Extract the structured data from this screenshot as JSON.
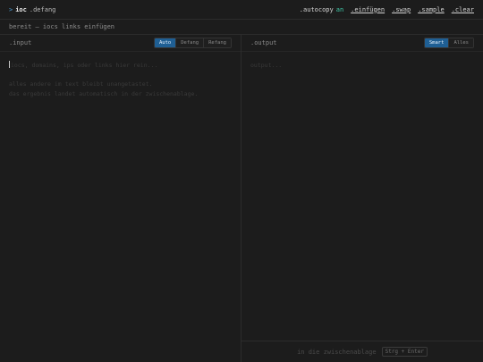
{
  "header": {
    "prompt": ">",
    "brand_bold": "ioc",
    "brand_rest": ".defang",
    "autocopy_label": ".autocopy",
    "autocopy_state": "an",
    "links": [
      ".einfügen",
      ".swap",
      ".sample",
      ".clear"
    ]
  },
  "status": {
    "text": "bereit — iocs links einfügen"
  },
  "input_pane": {
    "title": ".input",
    "modes": [
      "Auto",
      "Defang",
      "Refang"
    ],
    "active_mode": "Auto",
    "placeholder_lines": [
      "iocs, domains, ips oder links hier rein...",
      "",
      "alles andere im text bleibt unangetastet.",
      "das ergebnis landet automatisch in der zwischenablage."
    ]
  },
  "output_pane": {
    "title": ".output",
    "modes": [
      "Smart",
      "Alles"
    ],
    "active_mode": "Smart",
    "placeholder": "output..."
  },
  "footer": {
    "text": "in die zwischenablage",
    "shortcut": "Strg + Enter"
  },
  "colors": {
    "background": "#1c1c1c",
    "accent": "#1f5f94",
    "on": "#3fc6a7"
  }
}
